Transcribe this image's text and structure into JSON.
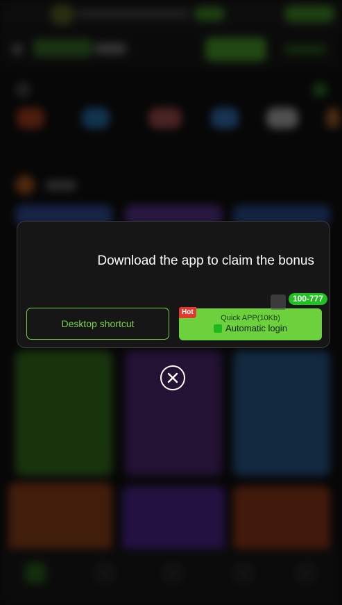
{
  "modal": {
    "title": "Download the app to claim the bonus",
    "desktop_shortcut_label": "Desktop shortcut",
    "quick_app": {
      "hot_badge": "Hot",
      "line1": "Quick APP(10Kb)",
      "line2": "Automatic login",
      "bonus_badge": "100-777"
    },
    "close_icon": "close-circle-icon"
  },
  "colors": {
    "accent_green": "#6dd13e",
    "outline_green": "#7ad34a",
    "hot_red": "#e03a2e",
    "badge_green": "#20c020",
    "modal_bg": "#161616"
  }
}
